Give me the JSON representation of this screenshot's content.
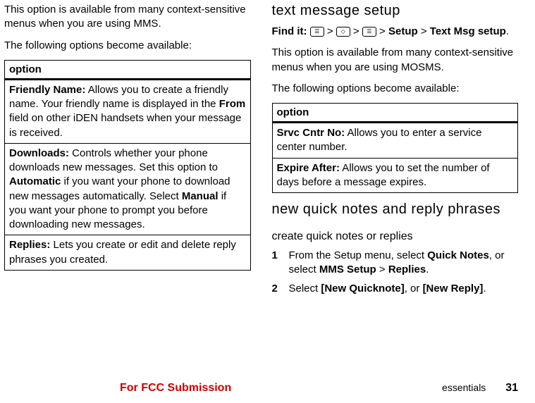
{
  "left": {
    "intro1": "This option is available from many context-sensitive menus when you are using MMS.",
    "intro2": "The following options become available:",
    "tableHeader": "option",
    "rows": [
      {
        "label": "Friendly Name:",
        "desc_a": " Allows you to create a friendly name. Your friendly name is displayed in the ",
        "bold1": "From",
        "desc_b": " field on other iDEN handsets when your message is received."
      },
      {
        "label": "Downloads:",
        "desc_a": " Controls whether your phone downloads new messages. Set this option to ",
        "bold1": "Automatic",
        "desc_b": " if you want your phone to download new messages automatically. Select ",
        "bold2": "Manual",
        "desc_c": " if you want your phone to prompt you before downloading new messages."
      },
      {
        "label": "Replies:",
        "desc_a": " Lets you create or edit and delete reply phrases you created."
      }
    ]
  },
  "right": {
    "heading": "text message setup",
    "findit_label": "Find it:",
    "findit_tail1": "Setup",
    "findit_tail2": "Text Msg setup",
    "intro1": "This option is available from many context-sensitive menus when you are using MOSMS.",
    "intro2": "The following options become available:",
    "tableHeader": "option",
    "rows": [
      {
        "label": "Srvc Cntr No:",
        "desc": " Allows you to enter a service center number."
      },
      {
        "label": "Expire After:",
        "desc": " Allows you to set the number of days before a message expires."
      }
    ],
    "heading2": "new quick notes and reply phrases",
    "subheading": "create quick notes or replies",
    "step1_a": "From the Setup menu, select ",
    "step1_b1": "Quick Notes",
    "step1_c": ", or select ",
    "step1_b2": "MMS Setup",
    "step1_gt": " > ",
    "step1_b3": "Replies",
    "step1_end": ".",
    "step2_a": "Select ",
    "step2_b1": "[New Quicknote]",
    "step2_c": ", or ",
    "step2_b2": "[New Reply]",
    "step2_end": "."
  },
  "footer": {
    "fcc": "For FCC Submission",
    "section": "essentials",
    "page": "31"
  }
}
